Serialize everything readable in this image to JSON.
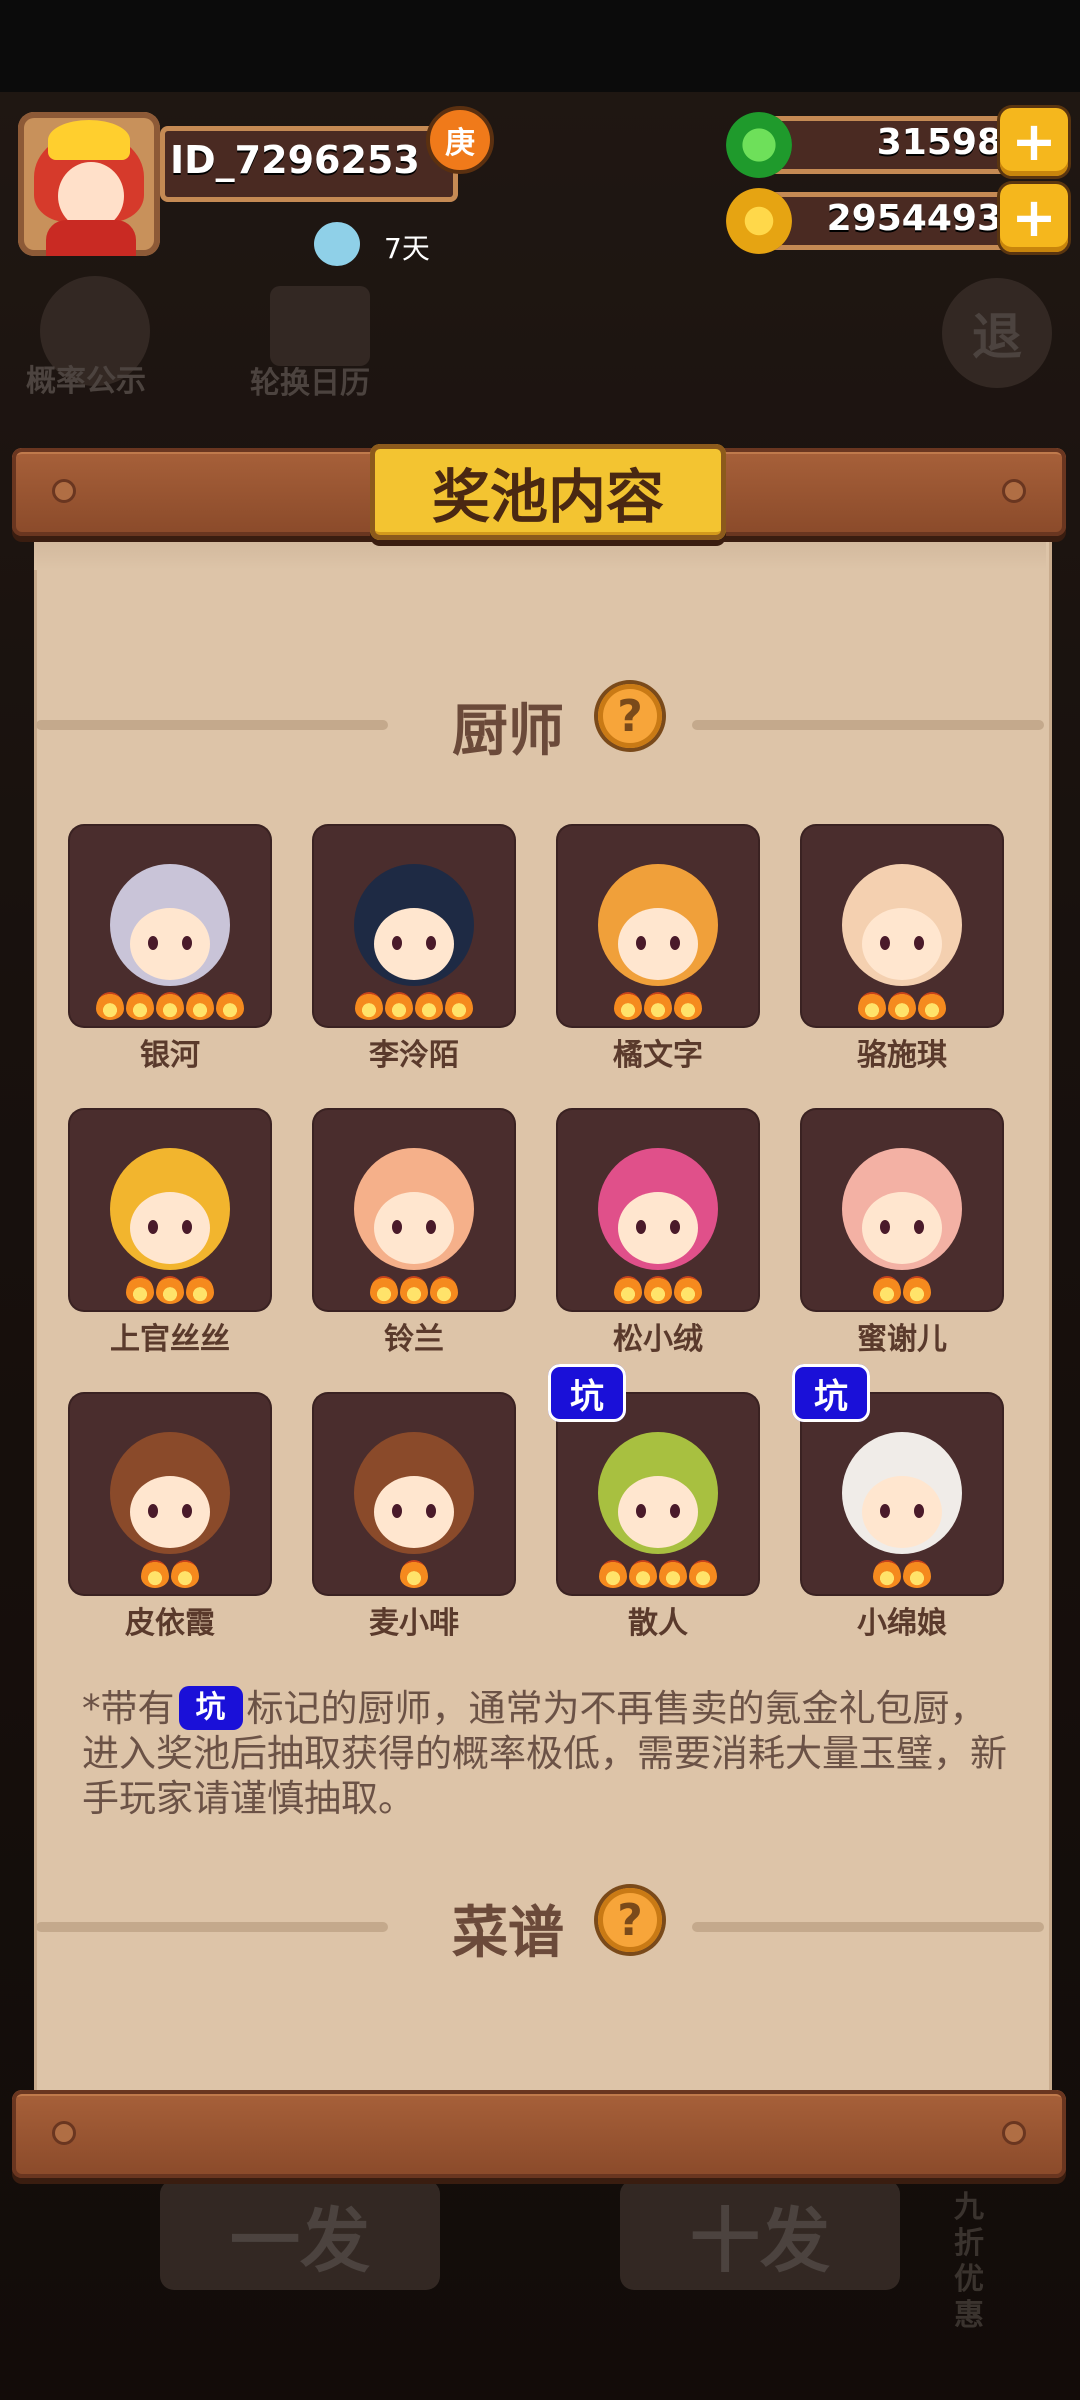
{
  "player": {
    "id": "ID_7296253",
    "badge": "庚",
    "timer": "7天"
  },
  "currency": {
    "jade": "31598",
    "coins": "2954493",
    "add_symbol": "+"
  },
  "background": {
    "probability_label": "概率公示",
    "rotation_label": "轮换日历",
    "exit_label": "退",
    "single_draw": "一发",
    "ten_draw": "十发",
    "discount": "九折优惠"
  },
  "modal": {
    "title": "奖池内容",
    "chefs_title": "厨师",
    "recipes_title": "菜谱",
    "help_symbol": "?",
    "pit_label": "坑",
    "note_prefix": "*带有",
    "note_suffix": "标记的厨师，通常为不再售卖的氪金礼包厨，进入奖池后抽取获得的概率极低，需要消耗大量玉璧，新手玩家请谨慎抽取。",
    "chefs": [
      {
        "name": "银河",
        "stars": 5,
        "pit": false
      },
      {
        "name": "李泠陌",
        "stars": 4,
        "pit": false
      },
      {
        "name": "橘文字",
        "stars": 3,
        "pit": false
      },
      {
        "name": "骆施琪",
        "stars": 3,
        "pit": false
      },
      {
        "name": "上官丝丝",
        "stars": 3,
        "pit": false
      },
      {
        "name": "铃兰",
        "stars": 3,
        "pit": false
      },
      {
        "name": "松小绒",
        "stars": 3,
        "pit": false
      },
      {
        "name": "蜜谢儿",
        "stars": 2,
        "pit": false
      },
      {
        "name": "皮依霞",
        "stars": 2,
        "pit": false
      },
      {
        "name": "麦小啡",
        "stars": 1,
        "pit": false
      },
      {
        "name": "散人",
        "stars": 4,
        "pit": true
      },
      {
        "name": "小绵娘",
        "stars": 2,
        "pit": true
      }
    ]
  },
  "colors": {
    "panel": "#ddc4a8",
    "plank": "#a8613a",
    "title_board": "#f3c431",
    "pit_tag": "#1a10d8",
    "card_bg": "#4a2d2d"
  }
}
